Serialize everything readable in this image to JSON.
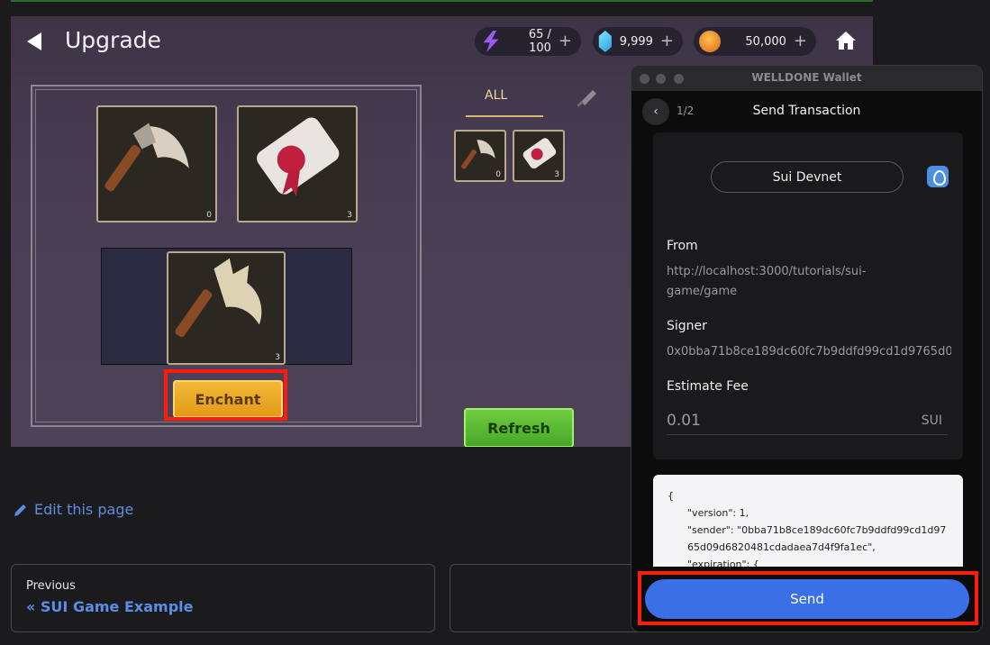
{
  "game": {
    "title": "Upgrade",
    "resources": {
      "energy": {
        "value": "65 / 100",
        "icon": "lightning-icon",
        "color": "#9b5bf2"
      },
      "gems": {
        "value": "9,999",
        "icon": "gem-icon",
        "color": "#3fb8f0"
      },
      "coins": {
        "value": "50,000",
        "icon": "coin-icon",
        "color": "#e8891f"
      }
    },
    "plus": "+",
    "craft": {
      "input_slots": [
        {
          "item": "axe",
          "count": "0"
        },
        {
          "item": "scroll",
          "count": "3"
        }
      ],
      "result_slot": {
        "item": "enchanted-axe",
        "count": "3"
      }
    },
    "enchant_label": "Enchant",
    "inventory": {
      "tabs": [
        {
          "label": "ALL"
        },
        {
          "label": "",
          "icon": "sword-icon"
        }
      ],
      "items": [
        {
          "item": "axe",
          "count": "0"
        },
        {
          "item": "scroll",
          "count": "3"
        }
      ]
    },
    "refresh_label": "Refresh"
  },
  "docs": {
    "edit_link": "Edit this page",
    "prev_label": "Previous",
    "prev_link": "« SUI Game Example"
  },
  "wallet": {
    "window_title": "WELLDONE Wallet",
    "step": "1/2",
    "heading": "Send Transaction",
    "network": "Sui Devnet",
    "from_label": "From",
    "from_value": "http://localhost:3000/tutorials/sui-game/game",
    "signer_label": "Signer",
    "signer_value": "0x0bba71b8ce189dc60fc7b9ddfd99cd1d9765d0",
    "fee_label": "Estimate Fee",
    "fee_value": "0.01",
    "fee_unit": "SUI",
    "json_lines": [
      "{",
      "\"version\": 1,",
      "\"sender\": \"0bba71b8ce189dc60fc7b9ddfd99cd1d9765d09d6820481cdadaea7d4f9fa1ec\",",
      "\"expiration\": {"
    ],
    "send_label": "Send"
  },
  "highlight_color": "#ff1c0a"
}
